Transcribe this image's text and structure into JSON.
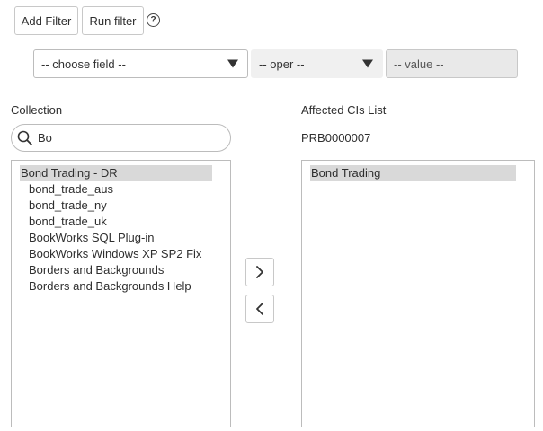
{
  "toolbar": {
    "add_filter_label": "Add Filter",
    "run_filter_label": "Run filter",
    "help_symbol": "?"
  },
  "filter": {
    "field_selected": "-- choose field --",
    "oper_selected": "-- oper --",
    "value_placeholder": "-- value --"
  },
  "collection": {
    "label": "Collection",
    "search_value": "Bo",
    "items": [
      "Bond Trading - DR",
      "bond_trade_aus",
      "bond_trade_ny",
      "bond_trade_uk",
      "BookWorks SQL Plug-in",
      "BookWorks Windows XP SP2 Fix",
      "Borders and Backgrounds",
      "Borders and Backgrounds Help"
    ],
    "selected_index": 0
  },
  "affected": {
    "label": "Affected CIs List",
    "record_number": "PRB0000007",
    "items": [
      "Bond Trading"
    ],
    "selected_index": 0
  },
  "icons": {
    "search": "search-icon",
    "add": "chevron-right-icon",
    "remove": "chevron-left-icon",
    "help": "help-circle-icon",
    "dropdown": "caret-down-icon"
  }
}
